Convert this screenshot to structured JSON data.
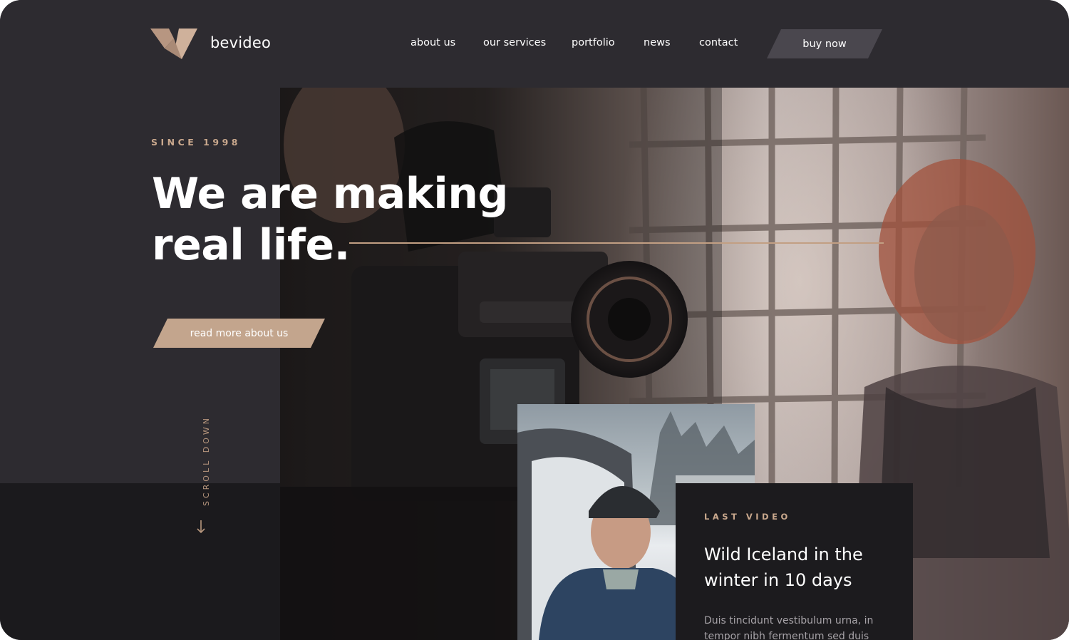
{
  "header": {
    "brand": "bevideo",
    "nav": [
      "about us",
      "our services",
      "portfolio",
      "news",
      "contact"
    ],
    "cta": "buy now"
  },
  "hero": {
    "eyebrow": "SINCE 1998",
    "headline_line1": "We are making",
    "headline_line2": "real life.",
    "button": "read more about us",
    "scroll": "SCROLL DOWN"
  },
  "video": {
    "label": "LAST VIDEO",
    "title_line1": "Wild Iceland in the",
    "title_line2": "winter in 10 days",
    "text_line1": "Duis tincidunt vestibulum urna, in",
    "text_line2": "tempor nibh fermentum sed duis"
  },
  "icons": [
    "logo-mark-icon",
    "arrow-down-icon"
  ],
  "colors": {
    "background": "#2d2b30",
    "accent": "#c3a58d",
    "card": "#1c1b1e",
    "button_dark": "#4a474e"
  }
}
